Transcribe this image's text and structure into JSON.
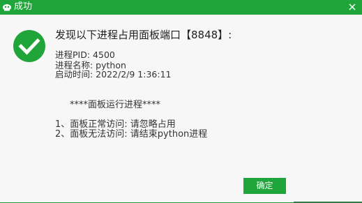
{
  "window": {
    "title": "成功",
    "accent_color": "#20a53a",
    "title_icon": "bt-logo-icon",
    "close_icon": "close-icon"
  },
  "message": {
    "status_icon": "checkmark-circle-icon",
    "heading": "发现以下进程占用面板端口【8848】:",
    "pid_line": "进程PID: 4500",
    "name_line": "进程名称: python",
    "time_line": "启动时间: 2022/2/9 1:36:11",
    "section_title": "****面板运行进程****",
    "advice": [
      "1、面板正常访问: 请忽略占用",
      "2、面板无法访问: 请结束python进程"
    ]
  },
  "buttons": {
    "ok_label": "确定"
  }
}
